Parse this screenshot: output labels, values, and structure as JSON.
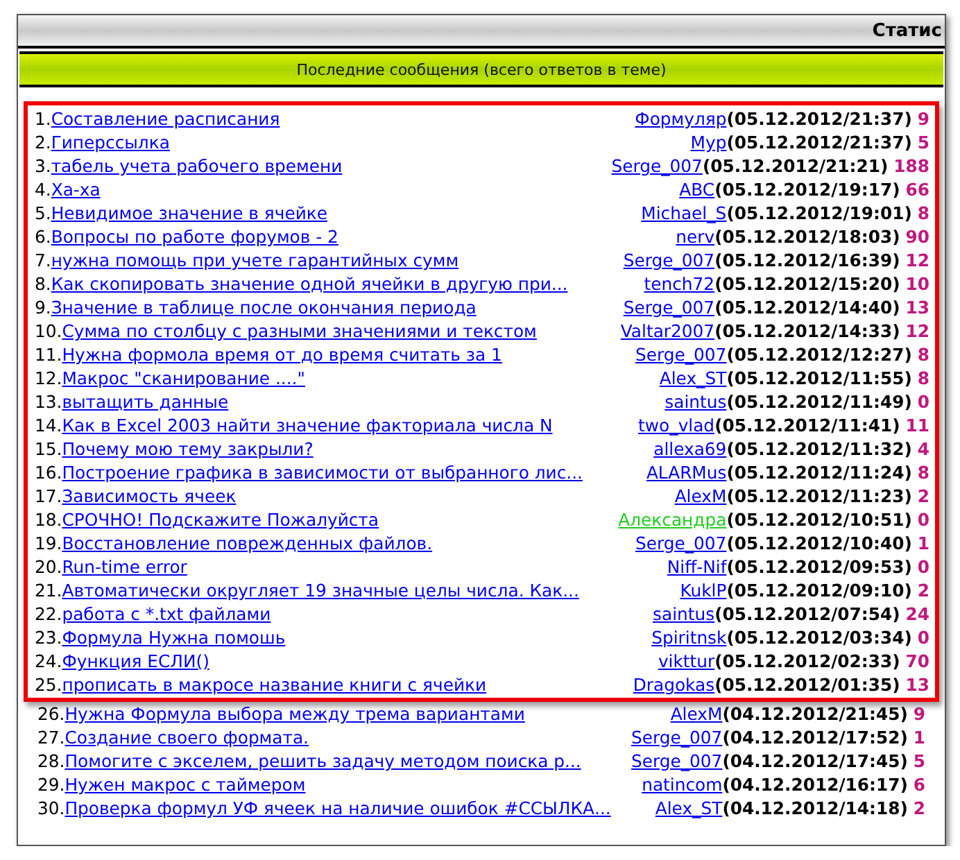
{
  "header": {
    "title": "Статис"
  },
  "section": {
    "title": "Последние сообщения (всего ответов в теме)"
  },
  "topics": [
    {
      "number": "1.",
      "title": "Составление расписания",
      "author": "Формуляр",
      "color": "#0000ee",
      "date": "(05.12.2012/21:37)",
      "replies": "9",
      "highlighted": true
    },
    {
      "number": "2.",
      "title": "Гиперссылка",
      "author": "Мур",
      "color": "#0000ee",
      "date": "(05.12.2012/21:37)",
      "replies": "5",
      "highlighted": true
    },
    {
      "number": "3.",
      "title": "табель учета рабочего времени",
      "author": "Serge_007",
      "color": "#0000ee",
      "date": "(05.12.2012/21:21)",
      "replies": "188",
      "highlighted": true
    },
    {
      "number": "4.",
      "title": "Ха-ха",
      "author": "ABC",
      "color": "#0000ee",
      "date": "(05.12.2012/19:17)",
      "replies": "66",
      "highlighted": true
    },
    {
      "number": "5.",
      "title": "Невидимое значение в ячейке",
      "author": "Michael_S",
      "color": "#0000ee",
      "date": "(05.12.2012/19:01)",
      "replies": "8",
      "highlighted": true
    },
    {
      "number": "6.",
      "title": "Вопросы по работе форумов - 2",
      "author": "nerv",
      "color": "#0000ee",
      "date": "(05.12.2012/18:03)",
      "replies": "90",
      "highlighted": true
    },
    {
      "number": "7.",
      "title": "нужна помощь при учете гарантийных сумм",
      "author": "Serge_007",
      "color": "#0000ee",
      "date": "(05.12.2012/16:39)",
      "replies": "12",
      "highlighted": true
    },
    {
      "number": "8.",
      "title": "Как скопировать значение одной ячейки в другую при...",
      "author": "tench72",
      "color": "#0000ee",
      "date": "(05.12.2012/15:20)",
      "replies": "10",
      "highlighted": true
    },
    {
      "number": "9.",
      "title": "Значение в таблице после окончания периода",
      "author": "Serge_007",
      "color": "#0000ee",
      "date": "(05.12.2012/14:40)",
      "replies": "13",
      "highlighted": true
    },
    {
      "number": "10.",
      "title": "Сумма по столбцу с разными значениями и текстом",
      "author": "Valtar2007",
      "color": "#0000ee",
      "date": "(05.12.2012/14:33)",
      "replies": "12",
      "highlighted": true
    },
    {
      "number": "11.",
      "title": "Нужна формола время от до время считать за 1",
      "author": "Serge_007",
      "color": "#0000ee",
      "date": "(05.12.2012/12:27)",
      "replies": "8",
      "highlighted": true
    },
    {
      "number": "12.",
      "title": "Макрос \"сканирование ....\"",
      "author": "Alex_ST",
      "color": "#0000ee",
      "date": "(05.12.2012/11:55)",
      "replies": "8",
      "highlighted": true
    },
    {
      "number": "13.",
      "title": "вытащить данные",
      "author": "saintus",
      "color": "#0000ee",
      "date": "(05.12.2012/11:49)",
      "replies": "0",
      "highlighted": true
    },
    {
      "number": "14.",
      "title": "Как в Excel 2003 найти значение факториала числа N",
      "author": "two_vlad",
      "color": "#0000ee",
      "date": "(05.12.2012/11:41)",
      "replies": "11",
      "highlighted": true
    },
    {
      "number": "15.",
      "title": "Почему мою тему закрыли?",
      "author": "allexa69",
      "color": "#0000ee",
      "date": "(05.12.2012/11:32)",
      "replies": "4",
      "highlighted": true
    },
    {
      "number": "16.",
      "title": "Построение графика в зависимости от выбранного лис...",
      "author": "ALARMus",
      "color": "#0000ee",
      "date": "(05.12.2012/11:24)",
      "replies": "8",
      "highlighted": true
    },
    {
      "number": "17.",
      "title": "Зависимость ячеек",
      "author": "AlexM",
      "color": "#0000ee",
      "date": "(05.12.2012/11:23)",
      "replies": "2",
      "highlighted": true
    },
    {
      "number": "18.",
      "title": "СРОЧНО! Подскажите Пожалуйста",
      "author": "Александра",
      "color": "#22cc22",
      "date": "(05.12.2012/10:51)",
      "replies": "0",
      "highlighted": true
    },
    {
      "number": "19.",
      "title": "Восстановление поврежденных файлов.",
      "author": "Serge_007",
      "color": "#0000ee",
      "date": "(05.12.2012/10:40)",
      "replies": "1",
      "highlighted": true
    },
    {
      "number": "20.",
      "title": "Run-time error",
      "author": "Niff-Nif",
      "color": "#0000ee",
      "date": "(05.12.2012/09:53)",
      "replies": "0",
      "highlighted": true
    },
    {
      "number": "21.",
      "title": "Автоматически округляет 19 значные целы числа. Как...",
      "author": "KuklP",
      "color": "#0000ee",
      "date": "(05.12.2012/09:10)",
      "replies": "2",
      "highlighted": true
    },
    {
      "number": "22.",
      "title": "работа с *.txt файлами",
      "author": "saintus",
      "color": "#0000ee",
      "date": "(05.12.2012/07:54)",
      "replies": "24",
      "highlighted": true
    },
    {
      "number": "23.",
      "title": "Формула Нужна помошь",
      "author": "Spiritnsk",
      "color": "#0000ee",
      "date": "(05.12.2012/03:34)",
      "replies": "0",
      "highlighted": true
    },
    {
      "number": "24.",
      "title": "Функция ЕСЛИ()",
      "author": "vikttur",
      "color": "#0000ee",
      "date": "(05.12.2012/02:33)",
      "replies": "70",
      "highlighted": true
    },
    {
      "number": "25.",
      "title": "прописать в макросе название книги с ячейки",
      "author": "Dragokas",
      "color": "#0000ee",
      "date": "(05.12.2012/01:35)",
      "replies": "13",
      "highlighted": true
    },
    {
      "number": "26.",
      "title": "Нужна Формула выбора между трема вариантами",
      "author": "AlexM",
      "color": "#0000ee",
      "date": "(04.12.2012/21:45)",
      "replies": "9",
      "highlighted": false
    },
    {
      "number": "27.",
      "title": "Создание своего формата.",
      "author": "Serge_007",
      "color": "#0000ee",
      "date": "(04.12.2012/17:52)",
      "replies": "1",
      "highlighted": false
    },
    {
      "number": "28.",
      "title": "Помогите с экселем, решить задачу методом поиска р...",
      "author": "Serge_007",
      "color": "#0000ee",
      "date": "(04.12.2012/17:45)",
      "replies": "5",
      "highlighted": false
    },
    {
      "number": "29.",
      "title": "Нужен макрос с таймером",
      "author": "natincom",
      "color": "#0000ee",
      "date": "(04.12.2012/16:17)",
      "replies": "6",
      "highlighted": false
    },
    {
      "number": "30.",
      "title": "Проверка формул УФ ячеек на наличие ошибок #ССЫЛКА...",
      "author": "Alex_ST",
      "color": "#0000ee",
      "date": "(04.12.2012/14:18)",
      "replies": "2",
      "highlighted": false
    }
  ]
}
